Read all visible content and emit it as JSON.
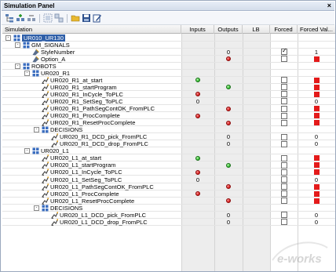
{
  "title": "Simulation Panel",
  "close_glyph": "×",
  "toolbar": {
    "buttons": [
      {
        "name": "tree-view-icon"
      },
      {
        "name": "add-signal-icon"
      },
      {
        "name": "remove-signal-icon"
      },
      {
        "name": "group-icon"
      },
      {
        "name": "ungroup-icon"
      },
      {
        "name": "open-folder-icon"
      },
      {
        "name": "save-icon"
      },
      {
        "name": "edit-icon"
      }
    ]
  },
  "columns": {
    "simulation": "Simulation",
    "inputs": "Inputs",
    "outputs": "Outputs",
    "lb": "LB",
    "forced": "Forced",
    "forced_value": "Forced Val..."
  },
  "rows": [
    {
      "label": "UR010_UR130",
      "level": 0,
      "kind": "compound",
      "expand": "-",
      "selected": true
    },
    {
      "label": "GM_SIGNALS",
      "level": 1,
      "kind": "compound",
      "expand": "-"
    },
    {
      "label": "StyleNumber",
      "level": 2,
      "kind": "signal",
      "output": "0",
      "forced": true,
      "forced_value": "1"
    },
    {
      "label": "Option_A",
      "level": 2,
      "kind": "signal",
      "output_dot": "red",
      "forced": false,
      "forced_square": true
    },
    {
      "label": "ROBOTS",
      "level": 1,
      "kind": "compound",
      "expand": "-"
    },
    {
      "label": "UR020_R1",
      "level": 2,
      "kind": "compound",
      "expand": "-"
    },
    {
      "label": "UR020_R1_at_start",
      "level": 3,
      "kind": "robot-signal",
      "input_dot": "green",
      "forced": false,
      "forced_square": true
    },
    {
      "label": "UR020_R1_startProgram",
      "level": 3,
      "kind": "robot-signal",
      "output_dot": "green",
      "forced": false,
      "forced_square": true
    },
    {
      "label": "UR020_R1_InCycle_ToPLC",
      "level": 3,
      "kind": "robot-signal",
      "input_dot": "red",
      "forced": false,
      "forced_square": true
    },
    {
      "label": "UR020_R1_SetSeg_ToPLC",
      "level": 3,
      "kind": "robot-signal",
      "input": "0",
      "forced": false,
      "forced_value": "0"
    },
    {
      "label": "UR020_R1_PathSegContOK_FromPLC",
      "level": 3,
      "kind": "robot-signal",
      "output_dot": "red",
      "forced": false,
      "forced_square": true
    },
    {
      "label": "UR020_R1_ProcComplete",
      "level": 3,
      "kind": "robot-signal",
      "input_dot": "red",
      "forced": false,
      "forced_square": true
    },
    {
      "label": "UR020_R1_ResetProcComplete",
      "level": 3,
      "kind": "robot-signal",
      "output_dot": "red",
      "forced": false,
      "forced_square": true
    },
    {
      "label": "DECISIONS",
      "level": 3,
      "kind": "compound",
      "expand": "-"
    },
    {
      "label": "UR020_R1_DCD_pick_FromPLC",
      "level": 4,
      "kind": "robot-signal",
      "output": "0",
      "forced": false,
      "forced_value": "0"
    },
    {
      "label": "UR020_R1_DCD_drop_FromPLC",
      "level": 4,
      "kind": "robot-signal",
      "output": "0",
      "forced": false,
      "forced_value": "0"
    },
    {
      "label": "UR020_L1",
      "level": 2,
      "kind": "compound",
      "expand": "-"
    },
    {
      "label": "UR020_L1_at_start",
      "level": 3,
      "kind": "robot-signal",
      "input_dot": "green",
      "forced": false,
      "forced_square": true
    },
    {
      "label": "UR020_L1_startProgram",
      "level": 3,
      "kind": "robot-signal",
      "output_dot": "green",
      "forced": false,
      "forced_square": true
    },
    {
      "label": "UR020_L1_InCycle_ToPLC",
      "level": 3,
      "kind": "robot-signal",
      "input_dot": "red",
      "forced": false,
      "forced_square": true
    },
    {
      "label": "UR020_L1_SetSeg_ToPLC",
      "level": 3,
      "kind": "robot-signal",
      "input": "0",
      "forced": false,
      "forced_value": "0"
    },
    {
      "label": "UR020_L1_PathSegContOK_FromPLC",
      "level": 3,
      "kind": "robot-signal",
      "output_dot": "red",
      "forced": false,
      "forced_square": true
    },
    {
      "label": "UR020_L1_ProcComplete",
      "level": 3,
      "kind": "robot-signal",
      "input_dot": "red",
      "forced": false,
      "forced_square": true
    },
    {
      "label": "UR020_L1_ResetProcComplete",
      "level": 3,
      "kind": "robot-signal",
      "output_dot": "red",
      "forced": false,
      "forced_square": true
    },
    {
      "label": "DECISIONS",
      "level": 3,
      "kind": "compound",
      "expand": "-"
    },
    {
      "label": "UR020_L1_DCD_pick_FromPLC",
      "level": 4,
      "kind": "robot-signal",
      "output": "0",
      "forced": false,
      "forced_value": "0"
    },
    {
      "label": "UR020_L1_DCD_drop_FromPLC",
      "level": 4,
      "kind": "robot-signal",
      "output": "0",
      "forced": false,
      "forced_value": "0"
    }
  ],
  "watermark": "e-works",
  "colors": {
    "selection": "#2f5fa8",
    "red": "#e41a1a",
    "green": "#22b022",
    "column_gray": "#ededed"
  }
}
